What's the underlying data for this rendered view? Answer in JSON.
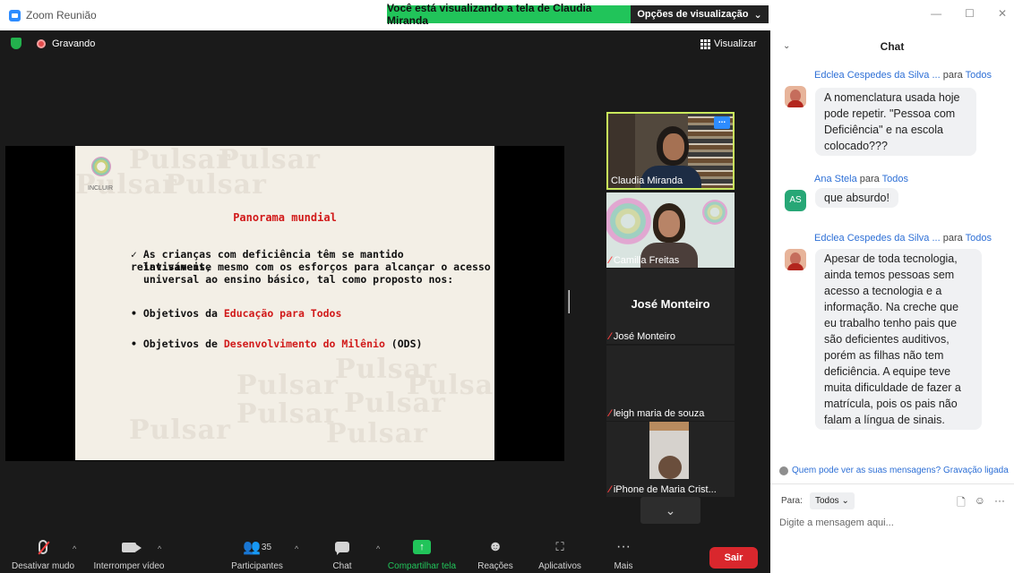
{
  "window": {
    "app_title": "Zoom Reunião",
    "share_banner": "Você está visualizando a tela de Claudia Miranda",
    "view_options": "Opções de visualização",
    "recording": "Gravando",
    "view_button": "Visualizar"
  },
  "slide": {
    "watermark": "Pulsar",
    "logo_text": "INCLUIR",
    "title": "Panorama mundial",
    "paragraph_lines": [
      "✓ As crianças com deficiência têm se mantido relativamente",
      "invisíveis, mesmo com os esforços para alcançar o acesso",
      "universal ao ensino básico, tal como proposto nos:"
    ],
    "bullet1_prefix": "• Objetivos da ",
    "bullet1_highlight": "Educação para Todos",
    "bullet2_prefix": "• Objetivos de ",
    "bullet2_highlight": "Desenvolvimento do Milênio",
    "bullet2_suffix": " (ODS)"
  },
  "participants": [
    {
      "name": "Claudia Miranda",
      "muted": false
    },
    {
      "name": "Camilla Freitas",
      "muted": true
    },
    {
      "name": "José Monteiro",
      "muted": true,
      "display_name": "José Monteiro"
    },
    {
      "name": "leigh maria de souza",
      "muted": true
    },
    {
      "name": "iPhone de Maria Crist...",
      "muted": true
    }
  ],
  "toolbar": {
    "mute": "Desativar mudo",
    "video": "Interromper vídeo",
    "participants": "Participantes",
    "participants_count": "35",
    "chat": "Chat",
    "share": "Compartilhar tela",
    "reactions": "Reações",
    "apps": "Aplicativos",
    "more": "Mais",
    "leave": "Sair"
  },
  "chat": {
    "title": "Chat",
    "messages": [
      {
        "sender": "Edclea Cespedes da Silva ...",
        "to_word": "para",
        "recipient": "Todos",
        "text": "A nomenclatura usada hoje pode repetir. \"Pessoa com Deficiência\" e na escola colocado???"
      },
      {
        "sender": "Ana Stela",
        "to_word": "para",
        "recipient": "Todos",
        "initials": "AS",
        "text": "que absurdo!"
      },
      {
        "sender": "Edclea Cespedes da Silva ...",
        "to_word": "para",
        "recipient": "Todos",
        "text": "Apesar de toda tecnologia, ainda temos pessoas sem acesso a tecnologia e a informação.  Na creche que eu trabalho tenho pais que são deficientes auditivos, porém as filhas não tem deficiência. A equipe teve muita dificuldade de fazer a matrícula, pois os pais não falam a língua de sinais."
      }
    ],
    "privacy_text": "Quem pode ver as suas mensagens? Gravação ligada",
    "to_label": "Para:",
    "to_value": "Todos",
    "input_placeholder": "Digite a mensagem aqui..."
  },
  "colors": {
    "share_green": "#21c45a",
    "leave_red": "#d9272d",
    "link_blue": "#2d6fd6",
    "active_speaker": "#c9e85c"
  },
  "icons": [
    "shield-icon",
    "record-icon",
    "grid-icon",
    "mic-muted-icon",
    "camera-icon",
    "participants-icon",
    "chat-icon",
    "share-screen-icon",
    "reactions-icon",
    "apps-icon",
    "more-icon",
    "chevron-down-icon",
    "file-icon",
    "emoji-icon"
  ]
}
